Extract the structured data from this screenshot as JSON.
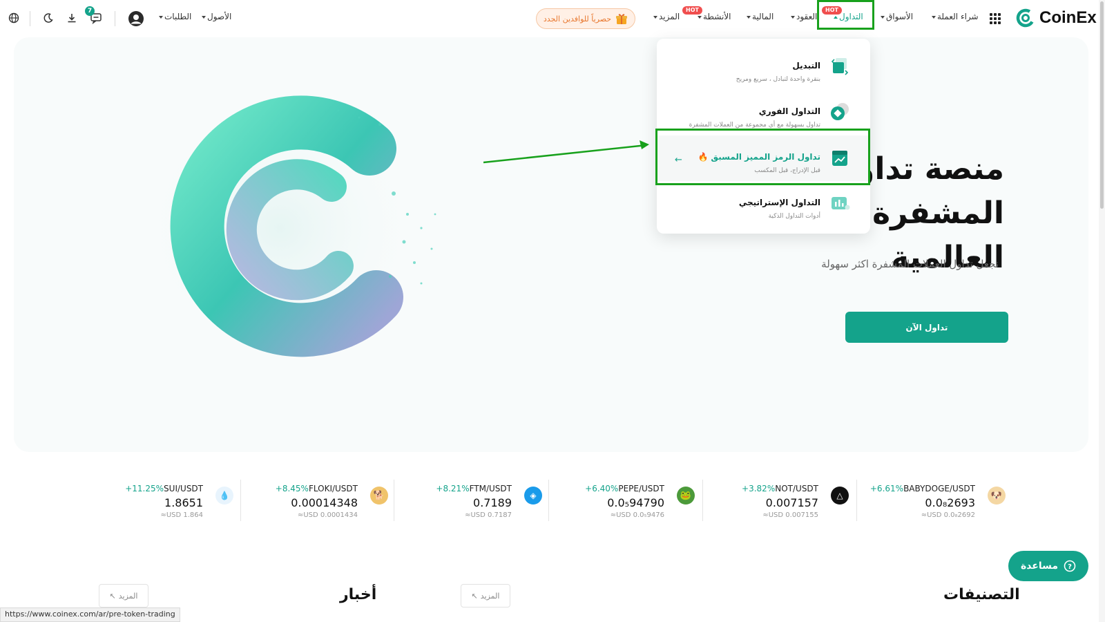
{
  "brand": {
    "name": "CoinEx",
    "accent": "#14a38b",
    "highlight": "#18a11c"
  },
  "nav": {
    "buy_crypto": "شراء العملة",
    "markets": "الأسواق",
    "trade": "التداول",
    "futures": "العقود",
    "finance": "المالية",
    "activities": "الأنشطة",
    "more": "المزيد",
    "hot": "HOT",
    "promo": "حصرياً للوافدين الجدد",
    "assets": "الأصول",
    "orders": "الطلبات",
    "notifications_count": "7"
  },
  "hero": {
    "title_line1": "منصة تداول العملات المشفرة",
    "title_line2": "العالمية",
    "subtitle": "نجعل تداول العملات المشفرة اكثر سهولة",
    "cta": "تداول الآن"
  },
  "dropdown": {
    "items": [
      {
        "title": "التبديل",
        "desc": "بنقرة واحدة لتبادل ، سريع ومريح"
      },
      {
        "title": "التداول الفوري",
        "desc": "تداول بسهولة مع أي مجموعة من العملات المشفرة"
      },
      {
        "title": "تداول الرمز المميز المسبق",
        "desc": "قبل الإدراج، قبل المكسب"
      },
      {
        "title": "التداول الإستراتيجي",
        "desc": "أدوات التداول الذكية"
      }
    ]
  },
  "tickers": [
    {
      "pair": "BABYDOGE/USDT",
      "change": "+6.61%",
      "price": "0.0₈2693",
      "usd": "≈USD 0.0₈2692",
      "icon": "babydoge-icon"
    },
    {
      "pair": "NOT/USDT",
      "change": "+3.82%",
      "price": "0.007157",
      "usd": "≈USD 0.007155",
      "icon": "not-icon"
    },
    {
      "pair": "PEPE/USDT",
      "change": "+6.40%",
      "price": "0.0₅94790",
      "usd": "≈USD 0.0₅9476",
      "icon": "pepe-icon"
    },
    {
      "pair": "FTM/USDT",
      "change": "+8.21%",
      "price": "0.7189",
      "usd": "≈USD 0.7187",
      "icon": "ftm-icon"
    },
    {
      "pair": "FLOKI/USDT",
      "change": "+8.45%",
      "price": "0.00014348",
      "usd": "≈USD 0.0001434",
      "icon": "floki-icon"
    },
    {
      "pair": "SUI/USDT",
      "change": "+11.25%",
      "price": "1.8651",
      "usd": "≈USD 1.864",
      "icon": "sui-icon"
    }
  ],
  "bottom": {
    "rankings": "التصنيفات",
    "news": "أخبار",
    "more": "المزيد",
    "help": "مساعدة"
  },
  "statusbar": {
    "url": "https://www.coinex.com/ar/pre-token-trading"
  }
}
